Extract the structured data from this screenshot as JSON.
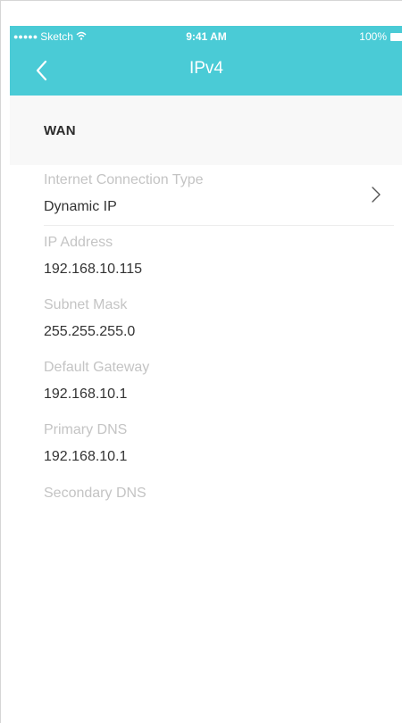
{
  "status_bar": {
    "carrier": "Sketch",
    "time": "9:41 AM",
    "battery": "100%"
  },
  "nav": {
    "title": "IPv4"
  },
  "section": {
    "title": "WAN"
  },
  "connection": {
    "label": "Internet Connection Type",
    "value": "Dynamic IP"
  },
  "fields": {
    "ip_address": {
      "label": "IP Address",
      "value": "192.168.10.115"
    },
    "subnet_mask": {
      "label": "Subnet Mask",
      "value": "255.255.255.0"
    },
    "default_gateway": {
      "label": "Default Gateway",
      "value": "192.168.10.1"
    },
    "primary_dns": {
      "label": "Primary DNS",
      "value": "192.168.10.1"
    },
    "secondary_dns": {
      "label": "Secondary DNS",
      "value": ""
    }
  },
  "colors": {
    "accent": "#4acbd6",
    "label_gray": "#c4c4c4",
    "value_text": "#333333"
  },
  "icons": {
    "back": "chevron-left-icon",
    "disclosure": "chevron-right-icon",
    "wifi": "wifi-icon",
    "battery": "battery-icon",
    "signal": "signal-dots-icon"
  }
}
